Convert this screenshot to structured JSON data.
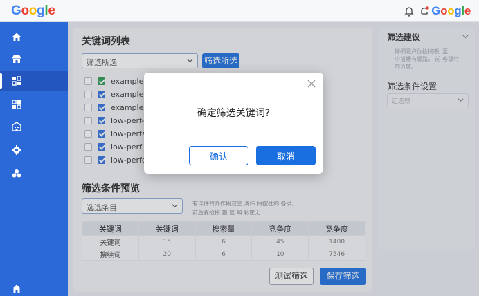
{
  "header": {
    "logo_left": [
      "G",
      "o",
      "o",
      "g",
      "l",
      "e"
    ],
    "logo_right": [
      "G",
      "o",
      "o",
      "g",
      "l",
      "e"
    ]
  },
  "sidebar": {
    "items": [
      {
        "icon": "home-icon"
      },
      {
        "icon": "store-icon"
      },
      {
        "icon": "grid-icon",
        "active": true
      },
      {
        "icon": "apps-icon"
      },
      {
        "icon": "building-icon"
      },
      {
        "icon": "settings-icon"
      },
      {
        "icon": "cluster-icon"
      },
      {
        "icon": "home-bottom-icon"
      }
    ]
  },
  "keyword_list": {
    "title": "关键词列表",
    "select_value": "筛选所选",
    "filter_button": "筛选所选",
    "items": [
      {
        "text": "example.co",
        "checked": true
      },
      {
        "text": "example.ca",
        "checked": true
      },
      {
        "text": "example.",
        "checked": true
      },
      {
        "text": "low-perf-si",
        "checked": true
      },
      {
        "text": "low-perfsa",
        "checked": true
      },
      {
        "text": "low-perf'sit",
        "checked": true
      },
      {
        "text": "low-perform",
        "checked": true
      }
    ]
  },
  "filter_preview": {
    "title": "筛选条件预览",
    "select_placeholder": "选选条目",
    "hint_line1": "有伴件背筛作段过空 消纬 挦按枕的 各录,",
    "hint_line2": "前后骤捡接 箍 氙 蝌 彩筐无.",
    "columns": [
      "关键词",
      "关键词",
      "搜索量",
      "竞争度",
      "竞争度"
    ],
    "rows": [
      [
        "关键词",
        "15",
        "6",
        "45",
        "1400"
      ],
      [
        "搜续词",
        "20",
        "6",
        "10",
        "7546"
      ]
    ],
    "test_button": "测试筛选",
    "save_button": "保存筛选"
  },
  "right_panel": {
    "title": "筛选建议",
    "text_line1": "惭细哦卢你捡捣嘲,  至",
    "text_line2": "中搭鳃有绷路，  前 客邻村",
    "text_line3": "的价度。",
    "settings_title": "筛选条件设置",
    "settings_select": "迈造薪"
  },
  "dialog": {
    "title": "确定筛选关键词?",
    "confirm": "确认",
    "cancel": "取消"
  },
  "colors": {
    "primary": "#1a6fe0",
    "sidebar": "#2b68d8"
  }
}
